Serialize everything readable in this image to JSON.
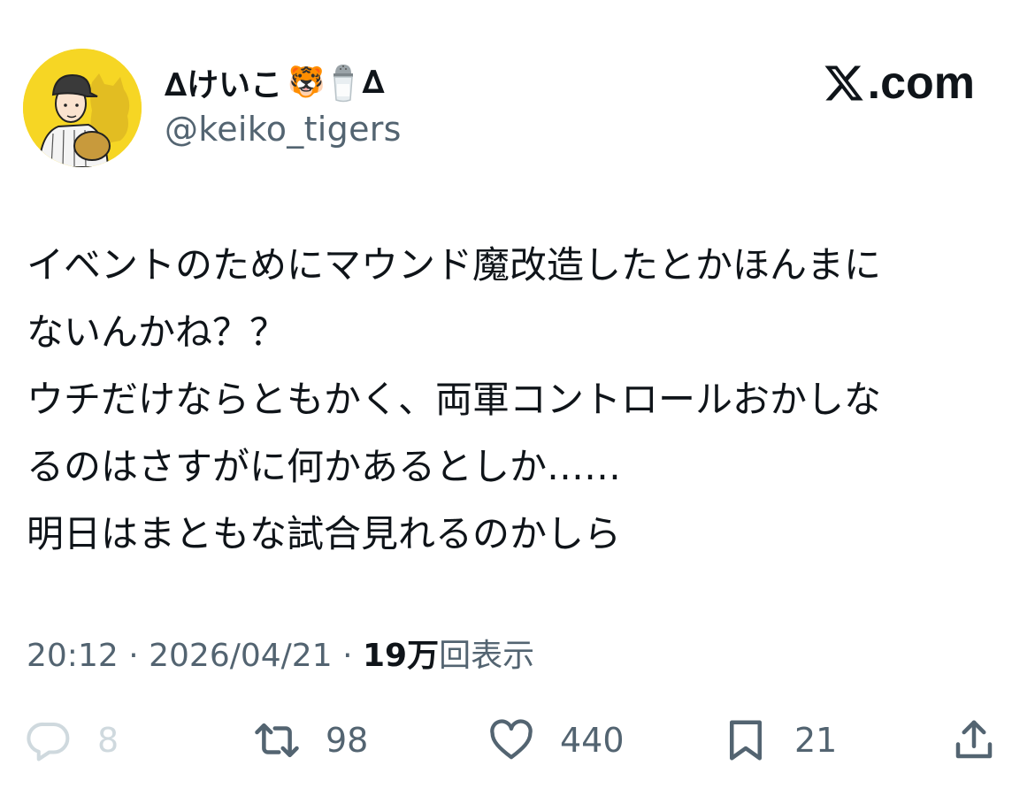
{
  "author": {
    "display_name_prefix": "∆けいこ",
    "display_name_emoji_1": "🐯",
    "display_name_emoji_2": "salt-shaker",
    "display_name_suffix": "∆",
    "handle": "@keiko_tigers",
    "avatar_bg": "#f6d624"
  },
  "brand": {
    "domain": ".com",
    "logo": "x-logo-icon"
  },
  "tweet": {
    "lines": [
      "イベントのためにマウンド魔改造したとかほんまに",
      "ないんかね？？",
      "ウチだけならともかく、両軍コントロールおかしな",
      "るのはさすがに何かあるとしか……",
      "明日はまともな試合見れるのかしら"
    ]
  },
  "meta": {
    "time": "20:12",
    "separator": "·",
    "date": "2026/04/21",
    "views_count": "19万",
    "views_label": "回表示"
  },
  "actions": {
    "replies": "8",
    "retweets": "98",
    "likes": "440",
    "bookmarks": "21"
  },
  "colors": {
    "text": "#0f1419",
    "secondary": "#536471",
    "muted": "#cfd9de"
  }
}
